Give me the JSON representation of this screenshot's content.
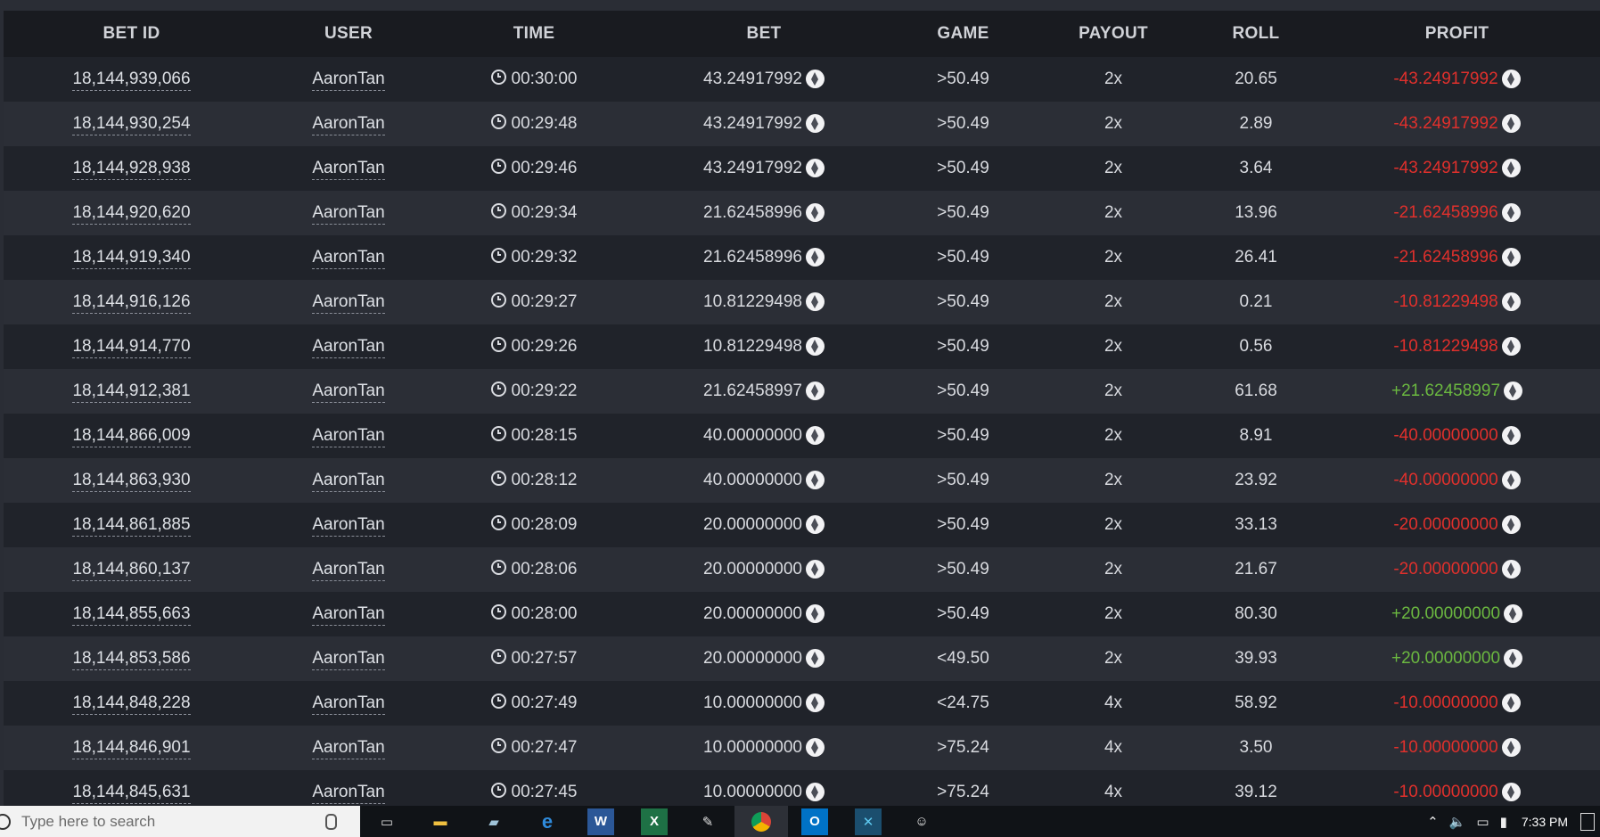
{
  "table": {
    "headers": [
      "BET ID",
      "USER",
      "TIME",
      "BET",
      "GAME",
      "PAYOUT",
      "ROLL",
      "PROFIT"
    ],
    "rows": [
      {
        "id": "18,144,939,066",
        "user": "AaronTan",
        "time": "00:30:00",
        "bet": "43.24917992",
        "game": ">50.49",
        "payout": "2x",
        "roll": "20.65",
        "profit": "-43.24917992",
        "win": false
      },
      {
        "id": "18,144,930,254",
        "user": "AaronTan",
        "time": "00:29:48",
        "bet": "43.24917992",
        "game": ">50.49",
        "payout": "2x",
        "roll": "2.89",
        "profit": "-43.24917992",
        "win": false
      },
      {
        "id": "18,144,928,938",
        "user": "AaronTan",
        "time": "00:29:46",
        "bet": "43.24917992",
        "game": ">50.49",
        "payout": "2x",
        "roll": "3.64",
        "profit": "-43.24917992",
        "win": false
      },
      {
        "id": "18,144,920,620",
        "user": "AaronTan",
        "time": "00:29:34",
        "bet": "21.62458996",
        "game": ">50.49",
        "payout": "2x",
        "roll": "13.96",
        "profit": "-21.62458996",
        "win": false
      },
      {
        "id": "18,144,919,340",
        "user": "AaronTan",
        "time": "00:29:32",
        "bet": "21.62458996",
        "game": ">50.49",
        "payout": "2x",
        "roll": "26.41",
        "profit": "-21.62458996",
        "win": false
      },
      {
        "id": "18,144,916,126",
        "user": "AaronTan",
        "time": "00:29:27",
        "bet": "10.81229498",
        "game": ">50.49",
        "payout": "2x",
        "roll": "0.21",
        "profit": "-10.81229498",
        "win": false
      },
      {
        "id": "18,144,914,770",
        "user": "AaronTan",
        "time": "00:29:26",
        "bet": "10.81229498",
        "game": ">50.49",
        "payout": "2x",
        "roll": "0.56",
        "profit": "-10.81229498",
        "win": false
      },
      {
        "id": "18,144,912,381",
        "user": "AaronTan",
        "time": "00:29:22",
        "bet": "21.62458997",
        "game": ">50.49",
        "payout": "2x",
        "roll": "61.68",
        "profit": "+21.62458997",
        "win": true
      },
      {
        "id": "18,144,866,009",
        "user": "AaronTan",
        "time": "00:28:15",
        "bet": "40.00000000",
        "game": ">50.49",
        "payout": "2x",
        "roll": "8.91",
        "profit": "-40.00000000",
        "win": false
      },
      {
        "id": "18,144,863,930",
        "user": "AaronTan",
        "time": "00:28:12",
        "bet": "40.00000000",
        "game": ">50.49",
        "payout": "2x",
        "roll": "23.92",
        "profit": "-40.00000000",
        "win": false
      },
      {
        "id": "18,144,861,885",
        "user": "AaronTan",
        "time": "00:28:09",
        "bet": "20.00000000",
        "game": ">50.49",
        "payout": "2x",
        "roll": "33.13",
        "profit": "-20.00000000",
        "win": false
      },
      {
        "id": "18,144,860,137",
        "user": "AaronTan",
        "time": "00:28:06",
        "bet": "20.00000000",
        "game": ">50.49",
        "payout": "2x",
        "roll": "21.67",
        "profit": "-20.00000000",
        "win": false
      },
      {
        "id": "18,144,855,663",
        "user": "AaronTan",
        "time": "00:28:00",
        "bet": "20.00000000",
        "game": ">50.49",
        "payout": "2x",
        "roll": "80.30",
        "profit": "+20.00000000",
        "win": true
      },
      {
        "id": "18,144,853,586",
        "user": "AaronTan",
        "time": "00:27:57",
        "bet": "20.00000000",
        "game": "<49.50",
        "payout": "2x",
        "roll": "39.93",
        "profit": "+20.00000000",
        "win": true
      },
      {
        "id": "18,144,848,228",
        "user": "AaronTan",
        "time": "00:27:49",
        "bet": "10.00000000",
        "game": "<24.75",
        "payout": "4x",
        "roll": "58.92",
        "profit": "-10.00000000",
        "win": false
      },
      {
        "id": "18,144,846,901",
        "user": "AaronTan",
        "time": "00:27:47",
        "bet": "10.00000000",
        "game": ">75.24",
        "payout": "4x",
        "roll": "3.50",
        "profit": "-10.00000000",
        "win": false
      },
      {
        "id": "18,144,845,631",
        "user": "AaronTan",
        "time": "00:27:45",
        "bet": "10.00000000",
        "game": ">75.24",
        "payout": "4x",
        "roll": "39.12",
        "profit": "-10.00000000",
        "win": false
      }
    ]
  },
  "colors": {
    "loss": "#e0302c",
    "win": "#6bb840"
  },
  "taskbar": {
    "search_placeholder": "Type here to search",
    "time": "7:33 PM",
    "icons": [
      "task-view-icon",
      "file-explorer-icon",
      "store-icon",
      "edge-icon",
      "word-icon",
      "excel-icon",
      "paint-icon",
      "chrome-icon",
      "outlook-icon",
      "app-x-icon",
      "game-icon"
    ]
  }
}
